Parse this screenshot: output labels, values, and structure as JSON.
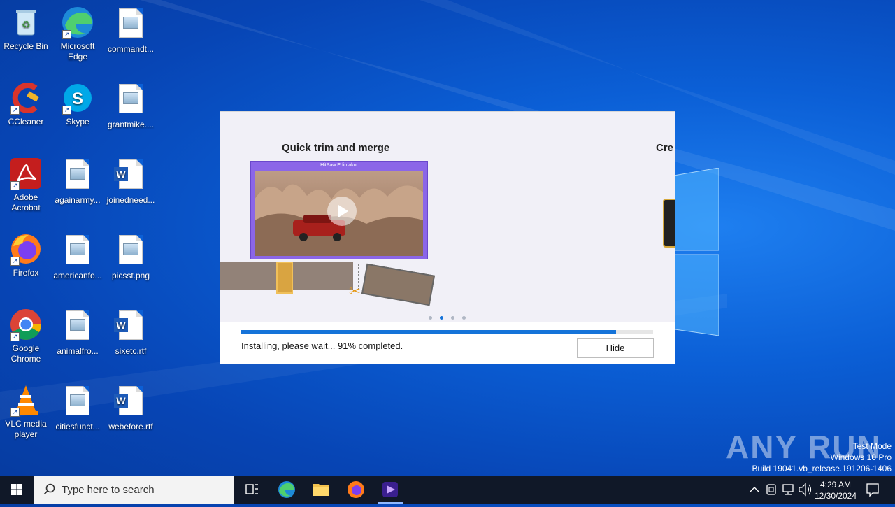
{
  "desktop": {
    "icons": [
      {
        "label": "Recycle Bin"
      },
      {
        "label": "Microsoft Edge"
      },
      {
        "label": "commandt..."
      },
      {
        "label": "CCleaner"
      },
      {
        "label": "Skype"
      },
      {
        "label": "grantmike...."
      },
      {
        "label": "Adobe Acrobat"
      },
      {
        "label": "againarmy..."
      },
      {
        "label": "joinedneed..."
      },
      {
        "label": "Firefox"
      },
      {
        "label": "americanfo..."
      },
      {
        "label": "picsst.png"
      },
      {
        "label": "Google Chrome"
      },
      {
        "label": "animalfro..."
      },
      {
        "label": "sixetc.rtf"
      },
      {
        "label": "VLC media player"
      },
      {
        "label": "citiesfunct..."
      },
      {
        "label": "webefore.rtf"
      }
    ]
  },
  "installer": {
    "slide_title": "Quick trim and merge",
    "slide_title_next": "Cre",
    "player_title": "HitPaw Edimakor",
    "progress_percent": 91,
    "status_text": "Installing, please wait... 91% completed.",
    "hide_label": "Hide",
    "carousel_active_index": 1,
    "carousel_count": 4
  },
  "watermark": {
    "anyrun": "ANY RUN",
    "line1": "Test Mode",
    "line2": "Windows 10 Pro",
    "line3": "Build 19041.vb_release.191206-1406"
  },
  "taskbar": {
    "search_placeholder": "Type here to search",
    "time": "4:29 AM",
    "date": "12/30/2024"
  },
  "colors": {
    "accent": "#1573d9",
    "player_frame": "#8b66e8",
    "taskbar": "#101828"
  }
}
